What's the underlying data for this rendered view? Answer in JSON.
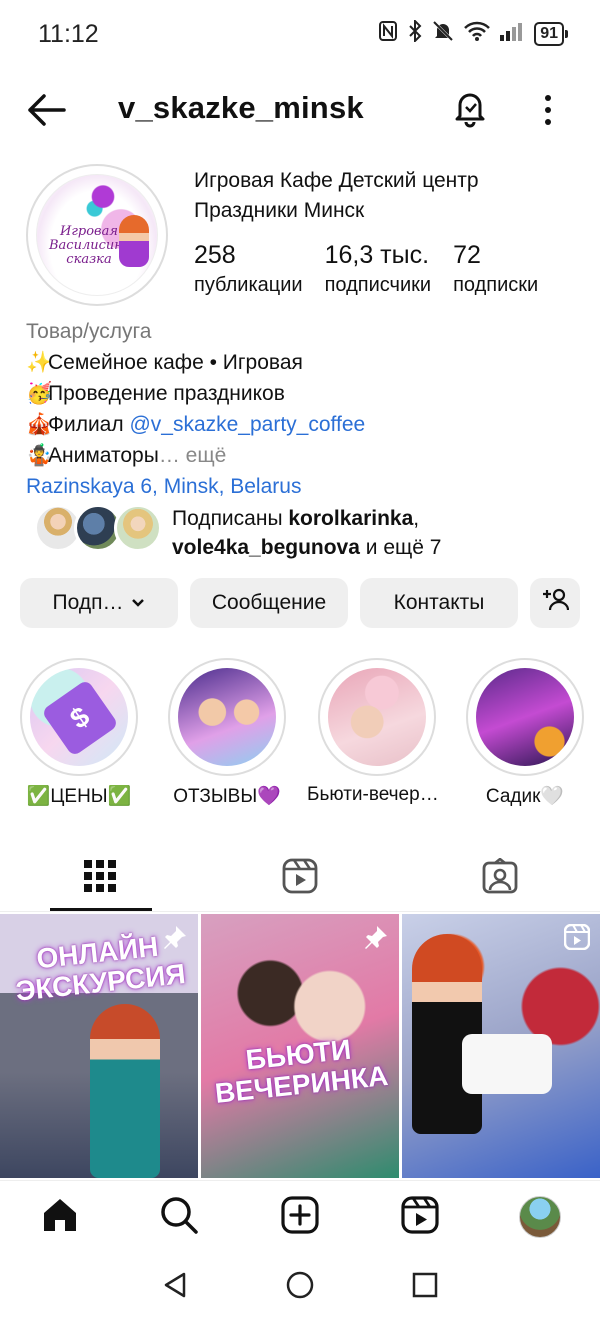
{
  "status_bar": {
    "time": "11:12",
    "battery": "91"
  },
  "header": {
    "username": "v_skazke_minsk"
  },
  "profile": {
    "avatar_logo_text": "Игровая Василисина сказка",
    "name_line1": "Игровая Кафе Детский центр",
    "name_line2": "Праздники Минск",
    "stats": [
      {
        "value": "258",
        "label": "публикации"
      },
      {
        "value": "16,3 тыс.",
        "label": "подписчики"
      },
      {
        "value": "72",
        "label": "подписки"
      }
    ],
    "category": "Товар/услуга",
    "bio": [
      {
        "emoji": "✨",
        "text": "Семейное кафе • Игровая"
      },
      {
        "emoji": "🥳",
        "text": "Проведение праздников"
      },
      {
        "emoji": "🎪",
        "text": "Филиал ",
        "link": "@v_skazke_party_coffee"
      },
      {
        "emoji": "🤹",
        "text": "Аниматоры",
        "more": "… ещё"
      }
    ],
    "address": "Razinskaya 6, Minsk, Belarus"
  },
  "followed_by": {
    "prefix": "Подписаны ",
    "user1": "korolkarinka",
    "sep": ",",
    "user2": "vole4ka_begunova",
    "suffix": " и ещё 7"
  },
  "buttons": {
    "follow": "Подп…",
    "message": "Сообщение",
    "contacts": "Контакты"
  },
  "highlights": [
    {
      "label": "✅ЦЕНЫ✅"
    },
    {
      "label": "ОТЗЫВЫ💜"
    },
    {
      "label": "Бьюти-вечеринка"
    },
    {
      "label": "Садик🤍"
    }
  ],
  "posts": [
    {
      "overlay": "ОНЛАЙН ЭКСКУРСИЯ",
      "pinned": true
    },
    {
      "overlay": "БЬЮТИ ВЕЧЕРИНКА",
      "pinned": true
    },
    {
      "overlay": "",
      "reel": true
    }
  ]
}
